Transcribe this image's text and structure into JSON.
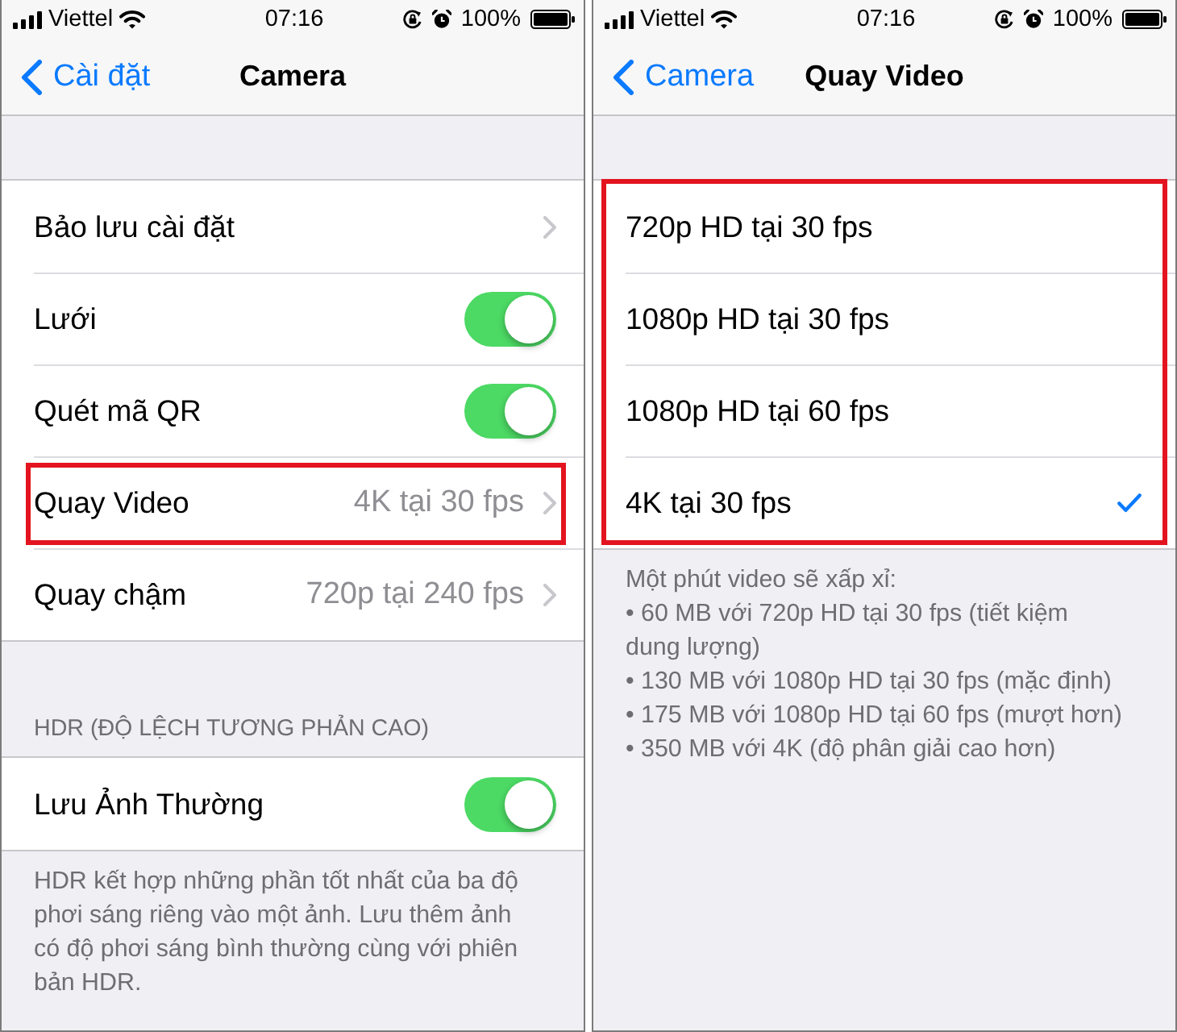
{
  "screens": [
    {
      "status_bar": {
        "carrier": "Viettel",
        "time": "07:16",
        "battery": "100%"
      },
      "nav_bar": {
        "back": "Cài đặt",
        "title": "Camera"
      },
      "sections": [
        {
          "highlighted": false,
          "rows": [
            {
              "kind": "link",
              "label": "Bảo lưu cài đặt",
              "highlighted": false
            },
            {
              "kind": "toggle",
              "label": "Lưới",
              "on": true,
              "highlighted": false
            },
            {
              "kind": "toggle",
              "label": "Quét mã QR",
              "on": true,
              "highlighted": false
            },
            {
              "kind": "link",
              "label": "Quay Video",
              "value": "4K tại 30 fps",
              "highlighted": true
            },
            {
              "kind": "link",
              "label": "Quay chậm",
              "value": "720p tại 240 fps",
              "highlighted": false
            }
          ]
        },
        {
          "highlighted": false,
          "header": "HDR (ĐỘ LỆCH TƯƠNG PHẢN CAO)",
          "rows": [
            {
              "kind": "toggle",
              "label": "Lưu Ảnh Thường",
              "on": true,
              "highlighted": false
            }
          ],
          "footer": [
            "HDR kết hợp những phần tốt nhất của ba độ phơi sáng riêng vào một ảnh. Lưu thêm ảnh có độ phơi sáng bình thường cùng với phiên bản HDR."
          ]
        }
      ]
    },
    {
      "status_bar": {
        "carrier": "Viettel",
        "time": "07:16",
        "battery": "100%"
      },
      "nav_bar": {
        "back": "Camera",
        "title": "Quay Video"
      },
      "sections": [
        {
          "highlighted": true,
          "rows": [
            {
              "kind": "option",
              "label": "720p HD tại 30 fps",
              "selected": false,
              "highlighted": false
            },
            {
              "kind": "option",
              "label": "1080p HD tại 30 fps",
              "selected": false,
              "highlighted": false
            },
            {
              "kind": "option",
              "label": "1080p HD tại 60 fps",
              "selected": false,
              "highlighted": false
            },
            {
              "kind": "option",
              "label": "4K tại 30 fps",
              "selected": true,
              "highlighted": false
            }
          ],
          "footer": [
            "Một phút video sẽ xấp xỉ:",
            "• 60 MB với 720p HD tại 30 fps (tiết kiệm dung lượng)",
            "• 130 MB với 1080p HD tại 30 fps (mặc định)",
            "• 175 MB với 1080p HD tại 60 fps (mượt hơn)",
            "• 350 MB với 4K (độ phân giải cao hơn)"
          ]
        }
      ]
    }
  ]
}
